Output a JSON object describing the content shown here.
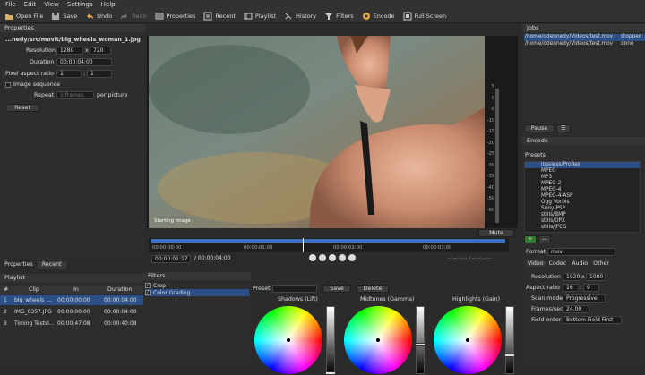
{
  "menu": [
    "File",
    "Edit",
    "View",
    "Settings",
    "Help"
  ],
  "toolbar": {
    "open_file": "Open File",
    "save": "Save",
    "undo": "Undo",
    "redo": "Redo",
    "properties": "Properties",
    "recent": "Recent",
    "playlist": "Playlist",
    "history": "History",
    "filters": "Filters",
    "encode": "Encode",
    "full_screen": "Full Screen"
  },
  "properties": {
    "title": "Properties",
    "filename": "...nedy/src/movit/blg_wheels_woman_1.jpg",
    "resolution_label": "Resolution",
    "res_w": "1280",
    "res_x": "x",
    "res_h": "720",
    "duration_label": "Duration",
    "duration": "00:00:04:00",
    "par_label": "Pixel aspect ratio",
    "par_a": "1",
    "par_sep": ":",
    "par_b": "1",
    "image_sequence": "Image sequence",
    "repeat_label": "Repeat",
    "repeat_value": "1 frames",
    "per_picture": "per picture",
    "reset": "Reset"
  },
  "viewer": {
    "caption": "Starting image",
    "vu_ticks": [
      "5",
      "0",
      "-5",
      "-10",
      "-15",
      "-20",
      "-25",
      "-30",
      "-35",
      "-40",
      "-50",
      "-60"
    ],
    "mute": "Mute",
    "timecodes": [
      "00:00:00;00",
      "00:00:01;00",
      "00:00:02;00",
      "00:00:03;00"
    ],
    "position": "00:00:01:17",
    "duration": "/ 00:00:04:00",
    "in_out": "--:--:--:-- / --:--:--:--"
  },
  "left_tabs": [
    "Properties",
    "Recent"
  ],
  "playlist": {
    "title": "Playlist",
    "headers": [
      "#",
      "Clip",
      "In",
      "Duration"
    ],
    "rows": [
      {
        "num": "1",
        "clip": "blg_wheels_...",
        "in": "00:00:00:00",
        "duration": "00:00:04:00"
      },
      {
        "num": "2",
        "clip": "IMG_0357.JPG",
        "in": "00:00:00:00",
        "duration": "00:00:04:00"
      },
      {
        "num": "3",
        "clip": "Timing Testsl...",
        "in": "00:00:47:08",
        "duration": "00:00:40:08"
      }
    ]
  },
  "filters": {
    "title": "Filters",
    "items": [
      {
        "label": "Crop",
        "checked": true
      },
      {
        "label": "Color Grading",
        "checked": true
      }
    ]
  },
  "color_grading": {
    "preset_label": "Preset",
    "save": "Save",
    "delete": "Delete",
    "wheels": [
      "Shadows (Lift)",
      "Midtones (Gamma)",
      "Highlights (Gain)"
    ]
  },
  "jobs": {
    "title": "Jobs",
    "rows": [
      {
        "path": "/home/ddennedy/Videos/test.mov",
        "status": "stopped"
      },
      {
        "path": "/home/ddennedy/Videos/test.mov",
        "status": "done"
      }
    ],
    "pause": "Pause"
  },
  "encode": {
    "title": "Encode",
    "presets_label": "Presets",
    "presets": [
      "lossless/ProRes",
      "MPEG",
      "MP3",
      "MPEG-2",
      "MPEG-4",
      "MPEG-4-ASP",
      "Ogg Vorbis",
      "Sony-PSP",
      "stills/BMP",
      "stills/DPX",
      "stills/JPEG"
    ],
    "format_label": "Format",
    "format": "mov",
    "tabs": [
      "Video",
      "Codec",
      "Audio",
      "Other"
    ],
    "resolution_label": "Resolution",
    "res_w": "1920",
    "res_x": "x",
    "res_h": "1080",
    "aspect_label": "Aspect ratio",
    "aspect_a": "16",
    "aspect_sep": ":",
    "aspect_b": "9",
    "scan_label": "Scan mode",
    "scan": "Progressive",
    "fps_label": "Frames/sec",
    "fps": "24.00",
    "field_label": "Field order",
    "field": "Bottom Field First"
  },
  "colors": {
    "accent": "#2f5b9a",
    "selection": "#2b4f86",
    "timeline": "#3c6fbf"
  }
}
